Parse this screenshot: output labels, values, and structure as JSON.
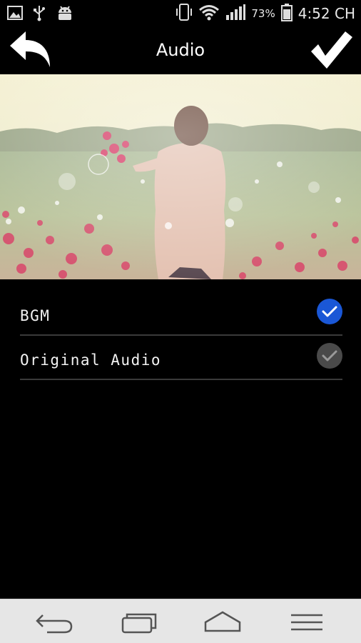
{
  "status_bar": {
    "battery_percent": "73%",
    "time": "4:52 CH"
  },
  "header": {
    "title": "Audio"
  },
  "options": [
    {
      "label": "BGM",
      "checked": true
    },
    {
      "label": "Original Audio",
      "checked": false
    }
  ],
  "colors": {
    "checked": "#1a57d6",
    "unchecked": "#4a4a4a",
    "nav_bar": "#e6e6e6"
  }
}
